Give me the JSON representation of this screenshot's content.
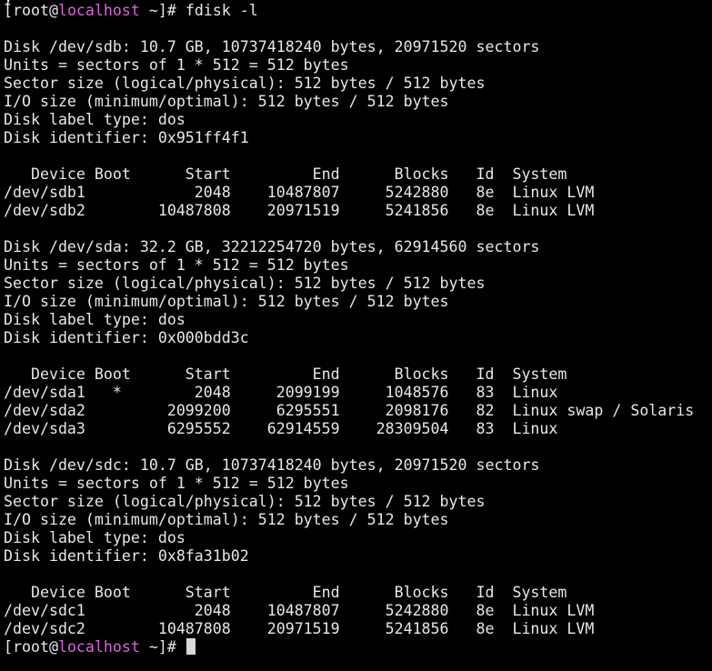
{
  "prompt": {
    "open": "[root@",
    "host": "localhost",
    "close": " ~]# ",
    "host_color": "#d966d9"
  },
  "command": "fdisk -l",
  "disks": [
    {
      "info": [
        "Disk /dev/sdb: 10.7 GB, 10737418240 bytes, 20971520 sectors",
        "Units = sectors of 1 * 512 = 512 bytes",
        "Sector size (logical/physical): 512 bytes / 512 bytes",
        "I/O size (minimum/optimal): 512 bytes / 512 bytes",
        "Disk label type: dos",
        "Disk identifier: 0x951ff4f1"
      ],
      "header": "   Device Boot      Start         End      Blocks   Id  System",
      "rows": [
        "/dev/sdb1            2048    10487807     5242880   8e  Linux LVM",
        "/dev/sdb2        10487808    20971519     5241856   8e  Linux LVM"
      ]
    },
    {
      "info": [
        "Disk /dev/sda: 32.2 GB, 32212254720 bytes, 62914560 sectors",
        "Units = sectors of 1 * 512 = 512 bytes",
        "Sector size (logical/physical): 512 bytes / 512 bytes",
        "I/O size (minimum/optimal): 512 bytes / 512 bytes",
        "Disk label type: dos",
        "Disk identifier: 0x000bdd3c"
      ],
      "header": "   Device Boot      Start         End      Blocks   Id  System",
      "rows": [
        "/dev/sda1   *        2048     2099199     1048576   83  Linux",
        "/dev/sda2         2099200     6295551     2098176   82  Linux swap / Solaris",
        "/dev/sda3         6295552    62914559    28309504   83  Linux"
      ]
    },
    {
      "info": [
        "Disk /dev/sdc: 10.7 GB, 10737418240 bytes, 20971520 sectors",
        "Units = sectors of 1 * 512 = 512 bytes",
        "Sector size (logical/physical): 512 bytes / 512 bytes",
        "I/O size (minimum/optimal): 512 bytes / 512 bytes",
        "Disk label type: dos",
        "Disk identifier: 0x8fa31b02"
      ],
      "header": "   Device Boot      Start         End      Blocks   Id  System",
      "rows": [
        "/dev/sdc1            2048    10487807     5242880   8e  Linux LVM",
        "/dev/sdc2        10487808    20971519     5241856   8e  Linux LVM"
      ]
    }
  ],
  "colors": {
    "background": "#000000",
    "foreground": "#e8e8e8",
    "cursor": "#d8d8d8"
  }
}
